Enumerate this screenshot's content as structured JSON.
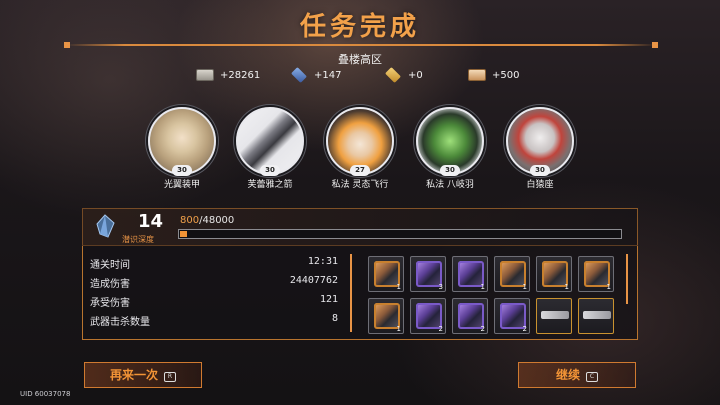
{
  "header": {
    "title": "任务完成",
    "stage_name": "叠楼高区"
  },
  "currencies": [
    {
      "icon": "cash-bill-icon",
      "value": "+28261"
    },
    {
      "icon": "blue-cube-icon",
      "value": "+147"
    },
    {
      "icon": "gold-gem-icon",
      "value": "+0"
    },
    {
      "icon": "ticket-icon",
      "value": "+500"
    }
  ],
  "characters": [
    {
      "name": "光翼装甲",
      "level": "30"
    },
    {
      "name": "芙蕾雅之箭",
      "level": "30"
    },
    {
      "name": "私法 灵态飞行",
      "level": "27"
    },
    {
      "name": "私法 八岐羽",
      "level": "30"
    },
    {
      "name": "白猿座",
      "level": "30"
    }
  ],
  "depth": {
    "value": "14",
    "label": "潜识深度",
    "xp_current": "800",
    "xp_total": "/48000",
    "xp_fraction": 0.0167
  },
  "stats": [
    {
      "label": "通关时间",
      "value": "12:31"
    },
    {
      "label": "造成伤害",
      "value": "24407762"
    },
    {
      "label": "承受伤害",
      "value": "121"
    },
    {
      "label": "武器击杀数量",
      "value": "8"
    }
  ],
  "rewards": [
    {
      "kind": "orange-crate",
      "count": "1"
    },
    {
      "kind": "purple-crate",
      "count": "3"
    },
    {
      "kind": "purple-crate",
      "count": "1"
    },
    {
      "kind": "orange-crate",
      "count": "1"
    },
    {
      "kind": "orange-crate",
      "count": "1"
    },
    {
      "kind": "orange-crate",
      "count": "1"
    },
    {
      "kind": "orange-crate",
      "count": "1"
    },
    {
      "kind": "purple-crate",
      "count": "2"
    },
    {
      "kind": "purple-crate",
      "count": "2"
    },
    {
      "kind": "purple-crate",
      "count": "2"
    },
    {
      "kind": "weapon",
      "count": ""
    },
    {
      "kind": "weapon",
      "count": ""
    }
  ],
  "buttons": {
    "retry_label": "再来一次",
    "retry_key": "R",
    "continue_label": "继续",
    "continue_key": "C"
  },
  "footer": {
    "uid": "UID 60037078"
  },
  "colors": {
    "accent": "#f29436",
    "panel_border": "#b8742e"
  }
}
